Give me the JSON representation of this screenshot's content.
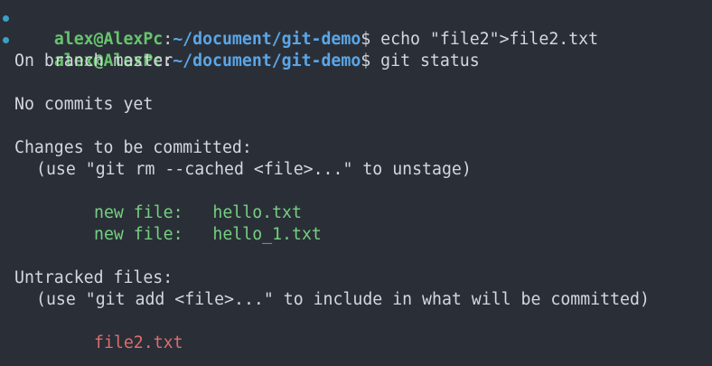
{
  "terminal": {
    "prompt1": {
      "user_host": "alex@AlexPc",
      "colon": ":",
      "path": "~/document/git-demo",
      "dollar": "$",
      "command": " echo \"file2\">file2.txt"
    },
    "prompt2": {
      "user_host": "alex@AlexPc",
      "colon": ":",
      "path": "~/document/git-demo",
      "dollar": "$",
      "command": " git status"
    },
    "output": {
      "branch": "On branch master",
      "no_commits": "No commits yet",
      "changes_header": "Changes to be committed:",
      "unstage_hint": "(use \"git rm --cached <file>...\" to unstage)",
      "staged_files": [
        "new file:   hello.txt",
        "new file:   hello_1.txt"
      ],
      "untracked_header": "Untracked files:",
      "untracked_hint": "(use \"git add <file>...\" to include in what will be committed)",
      "untracked_files": [
        "file2.txt"
      ]
    },
    "colors": {
      "background": "#2a2f37",
      "prompt_user": "#68c46e",
      "prompt_path": "#5aa6e8",
      "staged": "#76cf82",
      "untracked": "#e06c6c",
      "marker": "#3aa0c4"
    }
  }
}
